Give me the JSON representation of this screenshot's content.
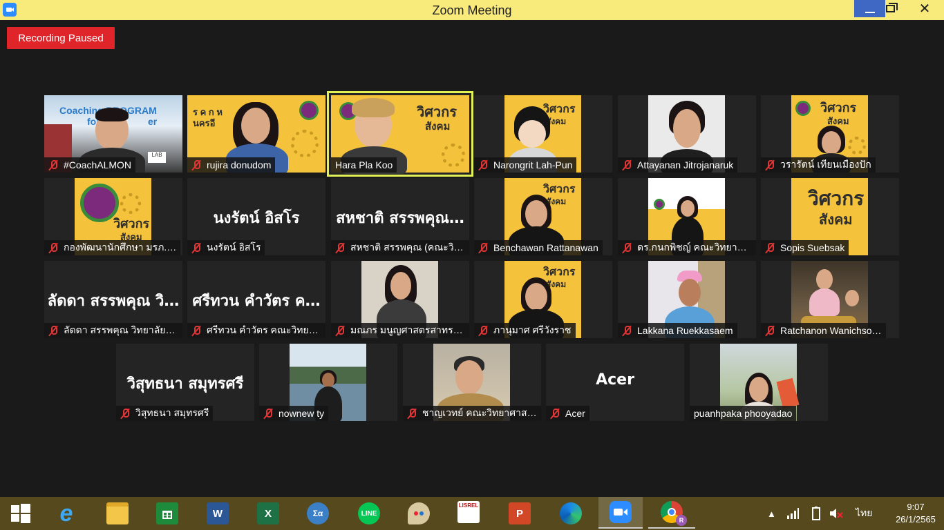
{
  "window": {
    "title": "Zoom Meeting"
  },
  "recording": {
    "label": "Recording Paused"
  },
  "colors": {
    "titlebar": "#f9ea7c",
    "recording": "#e0252a",
    "active_speaker": "#e2f155",
    "muted_mic": "#e23535",
    "taskbar": "#56491d"
  },
  "participants": [
    {
      "name": "#CoachALMON",
      "muted": true,
      "video": true
    },
    {
      "name": "rujira donudom",
      "muted": true,
      "video": true
    },
    {
      "name": "Hara Pla Koo",
      "muted": false,
      "video": true,
      "active_speaker": true
    },
    {
      "name": "Narongrit Lah-Pun",
      "muted": true,
      "video": true
    },
    {
      "name": "Attayanan Jitrojanaruk",
      "muted": true,
      "video": true
    },
    {
      "name": "วรารัตน์ เทียนเมืองปัก",
      "muted": true,
      "video": true
    },
    {
      "name": "กองพัฒนานักศึกษา มรภ.…",
      "muted": true,
      "video": true
    },
    {
      "name": "นงรัตน์ อิสโร",
      "muted": true,
      "video": false,
      "display_name": "นงรัตน์ อิสโร"
    },
    {
      "name": "สหชาติ สรรพคุณ (คณะวิท…",
      "muted": true,
      "video": false,
      "display_name": "สหชาติ สรรพคุณ…"
    },
    {
      "name": "Benchawan Rattanawan",
      "muted": true,
      "video": true
    },
    {
      "name": "ดร.กนกพิชญ์ คณะวิทยาก…",
      "muted": true,
      "video": true
    },
    {
      "name": "Sopis Suebsak",
      "muted": true,
      "video": true
    },
    {
      "name": "ลัดดา สรรพคุณ วิทยาลัยก…",
      "muted": true,
      "video": false,
      "display_name": "ลัดดา สรรพคุณ วิ…"
    },
    {
      "name": "ศรีทวน  คำวัตร คณะวิทยา…",
      "muted": true,
      "video": false,
      "display_name": "ศรีทวน  คำวัตร ค…"
    },
    {
      "name": "มณภร มนูญศาสตรสาทร …",
      "muted": true,
      "video": true
    },
    {
      "name": "ภานุมาศ ศรีวังราช",
      "muted": true,
      "video": true
    },
    {
      "name": "Lakkana Ruekkasaem",
      "muted": true,
      "video": true
    },
    {
      "name": "Ratchanon Wanichso…",
      "muted": true,
      "video": true
    },
    {
      "name": "วิสุทธนา สมุทรศรี",
      "muted": true,
      "video": false,
      "display_name": "วิสุทธนา สมุทรศรี"
    },
    {
      "name": "nownew ty",
      "muted": true,
      "video": true
    },
    {
      "name": "ชาญเวทย์  คณะวิทยาศาสตร์",
      "muted": true,
      "video": true
    },
    {
      "name": "Acer",
      "muted": true,
      "video": false,
      "display_name": "Acer"
    },
    {
      "name": "puanhpaka phooyadao",
      "muted": false,
      "video": true
    }
  ],
  "slide": {
    "title_line1": "วิศวกร",
    "title_line2": "สังคม",
    "coaching_text": "Coaching PROGRAM",
    "coaching_text2": "for",
    "coaching_text3": "er",
    "lab": "LAB",
    "rujira_text1": "ร ค ก ห",
    "rujira_text2": "นครอี"
  },
  "taskbar": {
    "apps": [
      {
        "name": "start",
        "icon": "windows-logo-icon"
      },
      {
        "name": "internet-explorer",
        "icon": "ie-icon",
        "label": "e"
      },
      {
        "name": "file-explorer",
        "icon": "folder-icon"
      },
      {
        "name": "store",
        "icon": "store-icon"
      },
      {
        "name": "word",
        "icon": "word-icon",
        "label": "W"
      },
      {
        "name": "excel",
        "icon": "excel-icon",
        "label": "X"
      },
      {
        "name": "calculator",
        "icon": "math-icon",
        "label": "Σα"
      },
      {
        "name": "line",
        "icon": "line-icon",
        "label": "LINE"
      },
      {
        "name": "paint",
        "icon": "paint-icon"
      },
      {
        "name": "lisrel",
        "icon": "lisrel-icon",
        "label": "LISREL"
      },
      {
        "name": "powerpoint",
        "icon": "powerpoint-icon",
        "label": "P"
      },
      {
        "name": "edge",
        "icon": "edge-icon"
      },
      {
        "name": "zoom",
        "icon": "zoom-icon"
      },
      {
        "name": "chrome",
        "icon": "chrome-icon",
        "label": "R"
      }
    ],
    "language": "ไทย",
    "time": "9:07",
    "date": "26/1/2565"
  }
}
